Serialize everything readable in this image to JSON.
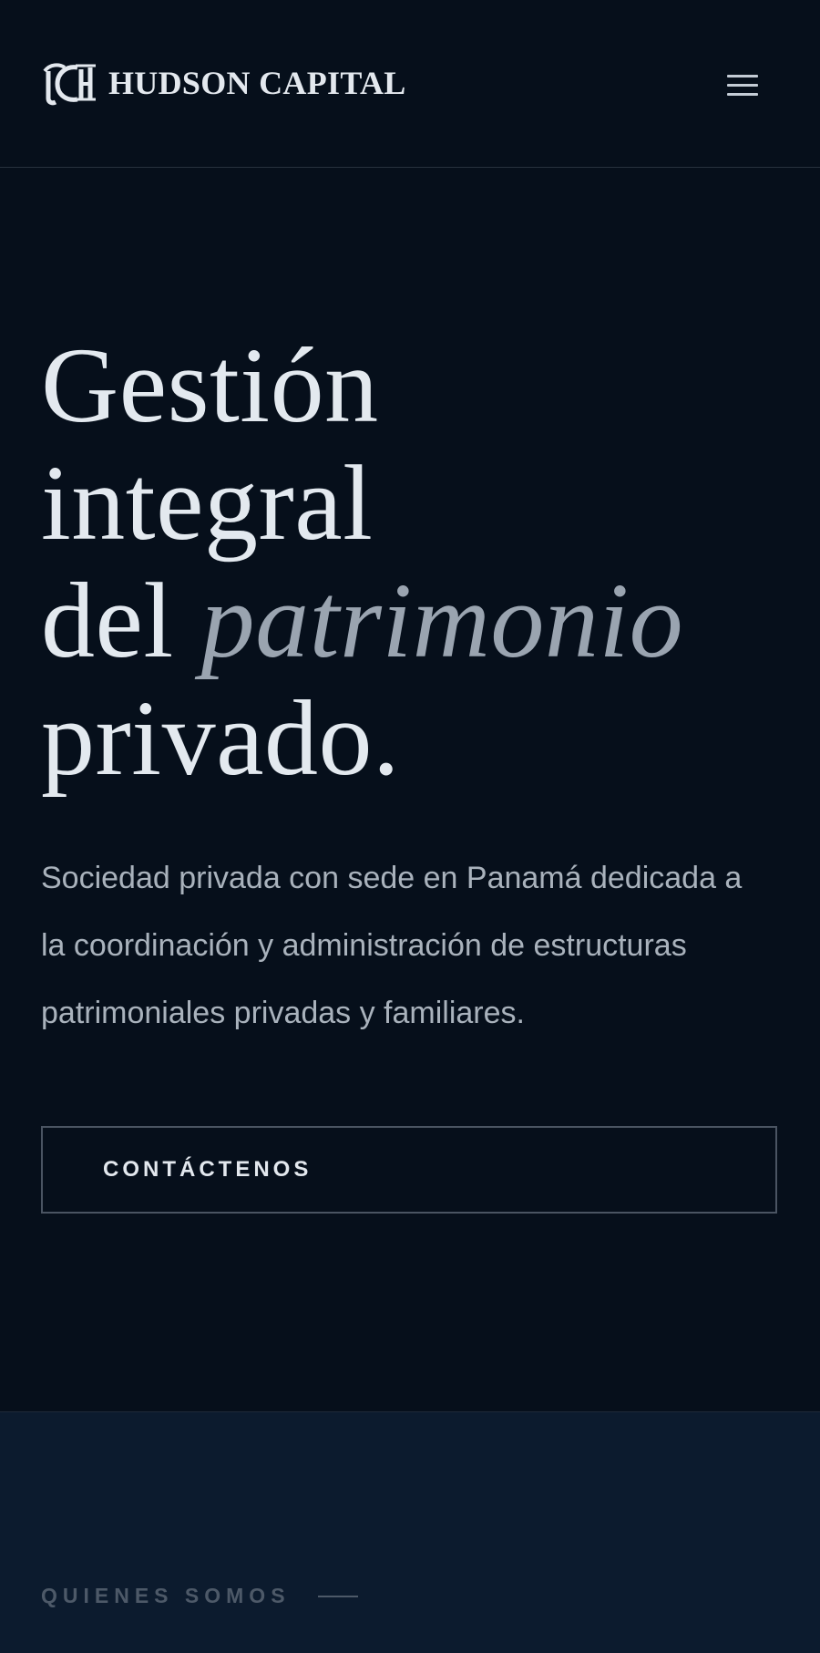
{
  "header": {
    "brand_name": "HUDSON CAPITAL",
    "logo_monogram": "HC",
    "menu_icon": "hamburger-menu-icon"
  },
  "hero": {
    "title_line1": "Gestión",
    "title_line2": "integral",
    "title_line3_prefix": "del",
    "title_line3_accent": "patrimonio",
    "title_line4": "privado.",
    "subtitle": "Sociedad privada con sede en Panamá dedicada a la coordinación y administración de estructuras patrimoniales privadas y familiares.",
    "cta_label": "CONTÁCTENOS"
  },
  "about": {
    "eyebrow": "QUIENES SOMOS"
  },
  "colors": {
    "background": "#060f1b",
    "section_background": "#0c1b2e",
    "heading": "#e3e9ef",
    "accent_italic": "#9aa4b0",
    "body_text": "#a9b2bc",
    "muted": "#4d5968"
  }
}
